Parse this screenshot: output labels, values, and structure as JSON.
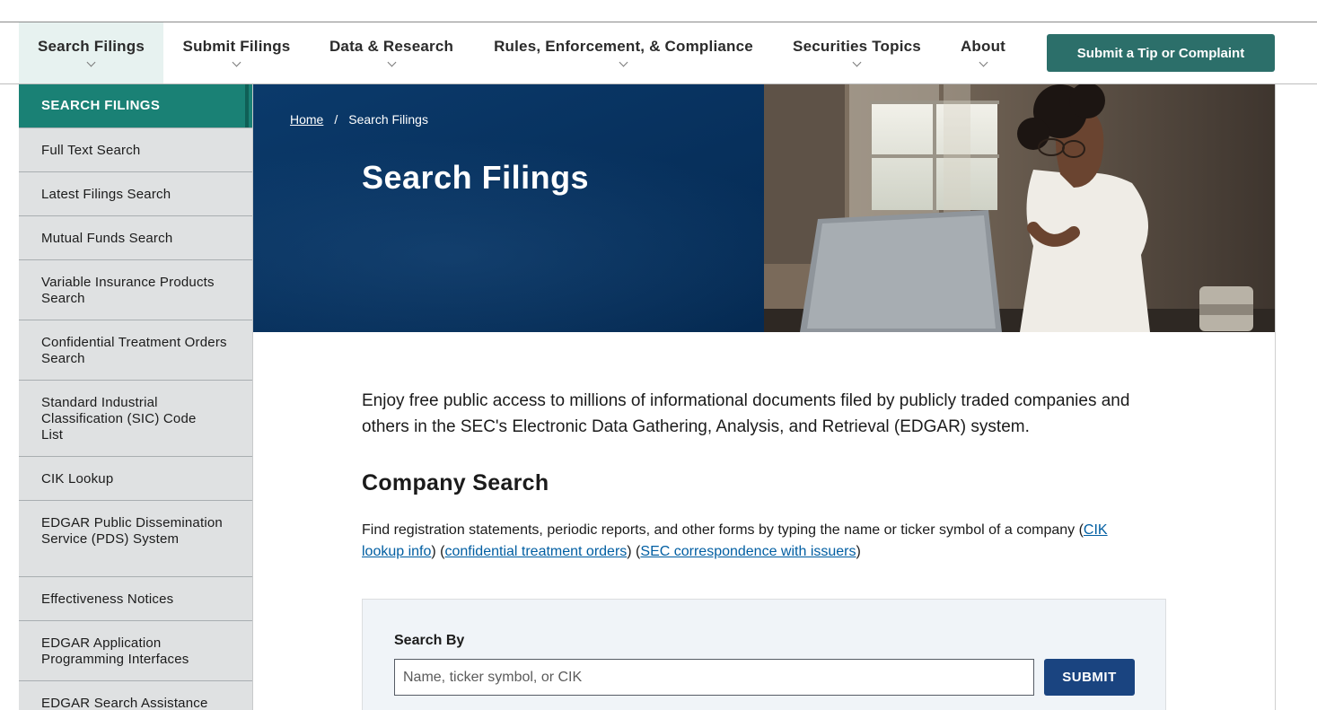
{
  "nav": {
    "items": [
      {
        "label": "Search Filings"
      },
      {
        "label": "Submit Filings"
      },
      {
        "label": "Data & Research"
      },
      {
        "label": "Rules, Enforcement, & Compliance"
      },
      {
        "label": "Securities Topics"
      },
      {
        "label": "About"
      }
    ],
    "tip_button": "Submit a Tip or Complaint"
  },
  "sidebar": {
    "heading": "SEARCH FILINGS",
    "items": [
      {
        "label": "Full Text Search"
      },
      {
        "label": "Latest Filings Search"
      },
      {
        "label": "Mutual Funds Search"
      },
      {
        "label": "Variable Insurance Products Search"
      },
      {
        "label": "Confidential Treatment Orders Search"
      },
      {
        "label": "Standard Industrial Classification (SIC) Code List"
      },
      {
        "label": "CIK Lookup"
      },
      {
        "label": "EDGAR Public Dissemination Service (PDS) System"
      },
      {
        "label": "Effectiveness Notices"
      },
      {
        "label": "EDGAR Application Programming Interfaces"
      },
      {
        "label": "EDGAR Search Assistance"
      }
    ]
  },
  "breadcrumb": {
    "home": "Home",
    "separator": "/",
    "current": "Search Filings"
  },
  "hero": {
    "title": "Search Filings"
  },
  "intro": "Enjoy free public access to millions of informational documents filed by publicly traded companies and others in the SEC's Electronic Data Gathering, Analysis, and Retrieval (EDGAR) system.",
  "company_search": {
    "heading": "Company Search",
    "desc_text": "Find registration statements, periodic reports, and other forms by typing the name or ticker symbol of a company (",
    "link_cik": "CIK lookup info",
    "sep1": ") (",
    "link_confidential": "confidential treatment orders",
    "sep2": ") (",
    "link_correspondence": "SEC correspondence with issuers",
    "end": ")"
  },
  "search_form": {
    "label": "Search By",
    "placeholder": "Name, ticker symbol, or CIK",
    "value": "",
    "submit": "SUBMIT"
  },
  "colors": {
    "nav_active_bg": "#e7f2f0",
    "tip_button": "#2c6f6a",
    "sidebar_head": "#1a8175",
    "hero_blue": "#07305c",
    "link": "#005ea2",
    "submit": "#1a4480"
  }
}
